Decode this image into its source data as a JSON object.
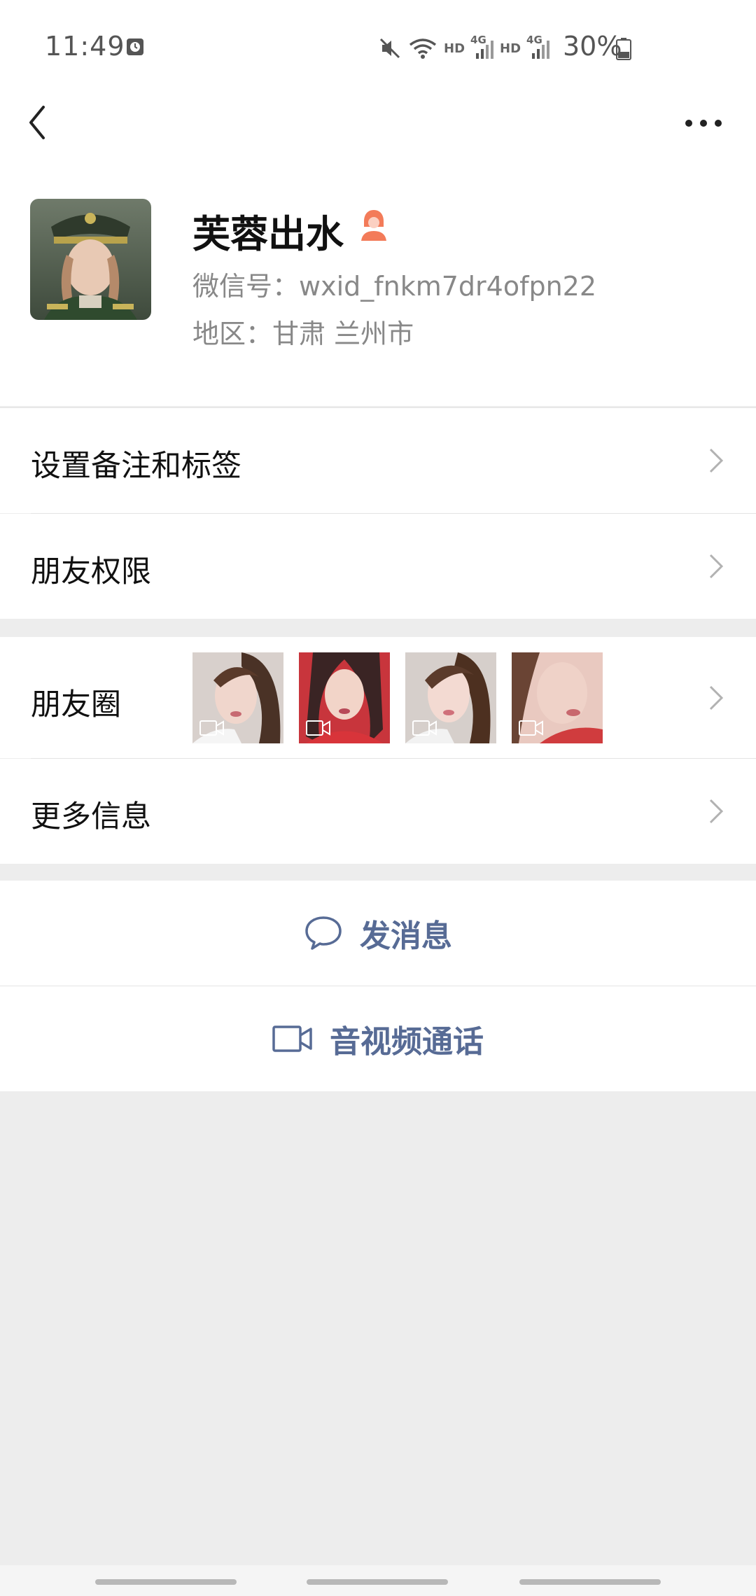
{
  "status_bar": {
    "time": "11:49",
    "battery": "30%",
    "signal_label_1": "HD",
    "signal_label_2": "HD",
    "network_label_1": "4G",
    "network_label_2": "4G",
    "icons": [
      "alarm-icon",
      "mute-icon",
      "wifi-icon",
      "signal-icon",
      "signal-icon",
      "battery-icon"
    ]
  },
  "header": {
    "back_icon": "chevron-left-icon",
    "more_icon": "more-icon"
  },
  "profile": {
    "name": "芙蓉出水",
    "gender_icon": "female-icon",
    "wechat_id": "微信号：wxid_fnkm7dr4ofpn22",
    "region": "地区：甘肃  兰州市"
  },
  "menu": {
    "remarks_label": "设置备注和标签",
    "permissions_label": "朋友权限",
    "moments_label": "朋友圈",
    "more_info_label": "更多信息"
  },
  "moments": {
    "thumbnails": [
      {
        "type": "video"
      },
      {
        "type": "video"
      },
      {
        "type": "video"
      },
      {
        "type": "video"
      }
    ]
  },
  "actions": {
    "send_message_label": "发消息",
    "call_label": "音视频通话"
  },
  "colors": {
    "link_blue": "#576b95",
    "gender_female": "#f37b59",
    "background": "#ededed"
  }
}
